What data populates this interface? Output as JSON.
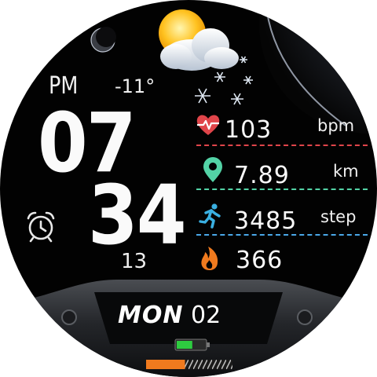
{
  "time": {
    "ampm": "PM",
    "hour": "07",
    "minute": "34",
    "seconds": "13"
  },
  "weather": {
    "temperature": "-11°",
    "condition_icon": "partly-cloudy-snow-icon"
  },
  "metrics": [
    {
      "icon": "heart-rate-icon",
      "value": "103",
      "unit": "bpm",
      "line_color": "#e0454a"
    },
    {
      "icon": "location-pin-icon",
      "value": "7.89",
      "unit": "km",
      "line_color": "#53d3a6"
    },
    {
      "icon": "running-person-icon",
      "value": "3485",
      "unit": "step",
      "line_color": "#4aa7e8"
    },
    {
      "icon": "flame-icon",
      "value": "366",
      "unit": ""
    }
  ],
  "date": {
    "weekday": "MON",
    "day": "02"
  },
  "battery": {
    "level": 0.55,
    "color": "#2ecc40"
  },
  "progress": {
    "level": 0.45,
    "color": "#f07a1e"
  },
  "colors": {
    "heart": "#e0454a",
    "location": "#53d3a6",
    "steps": "#3ab0e2",
    "calories": "#f07a1e"
  }
}
